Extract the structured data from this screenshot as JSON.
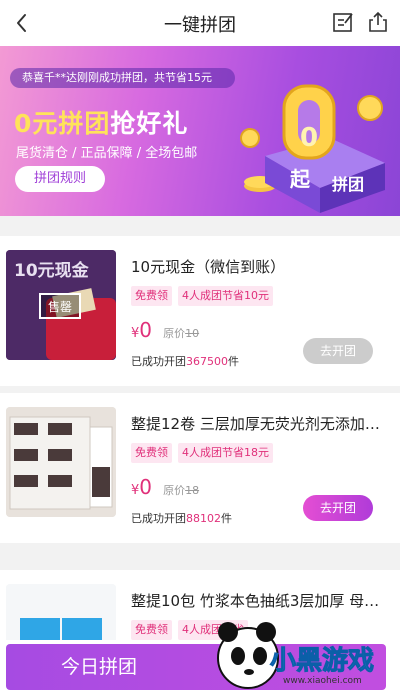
{
  "header": {
    "title": "一键拼团",
    "back_icon": "chevron-left-icon",
    "edit_icon": "edit-note-icon",
    "share_icon": "share-icon"
  },
  "banner": {
    "ticker": "恭喜千**达刚刚成功拼团，共节省15元",
    "headline_highlight": "0元拼团",
    "headline_rest": "抢好礼",
    "subline": "尾货清仓 / 正品保障 / 全场包邮",
    "rules_button": "拼团规则",
    "art_big_digit": "0",
    "art_label_1": "起",
    "art_label_2": "拼团"
  },
  "products": [
    {
      "name": "10元现金（微信到账）",
      "tag_free": "免费领",
      "tag_save": "4人成团节省10元",
      "currency": "¥",
      "price": "0",
      "orig_label": "原价",
      "orig_price": "10",
      "opened_prefix": "已成功开团",
      "opened_count": "367500",
      "opened_suffix": "件",
      "button": "去开团",
      "button_state": "disabled",
      "thumb_title": "10元现金",
      "thumb_badge": "售罄"
    },
    {
      "name": "整提12卷 三层加厚无荧光剂无添加…",
      "tag_free": "免费领",
      "tag_save": "4人成团节省18元",
      "currency": "¥",
      "price": "0",
      "orig_label": "原价",
      "orig_price": "18",
      "opened_prefix": "已成功开团",
      "opened_count": "88102",
      "opened_suffix": "件",
      "button": "去开团",
      "button_state": "active"
    },
    {
      "name": "整提10包 竹浆本色抽纸3层加厚 母…",
      "tag_free": "免费领",
      "tag_save": "4人成团节省"
    }
  ],
  "bottom": {
    "today_button": "今日拼团"
  },
  "watermark": {
    "text": "小黑游戏",
    "url": "www.xiaohei.com"
  },
  "colors": {
    "accent_pink": "#e0307a",
    "tag_bg": "#fde6f1",
    "purple": "#a64be2",
    "disabled": "#cccccc"
  }
}
